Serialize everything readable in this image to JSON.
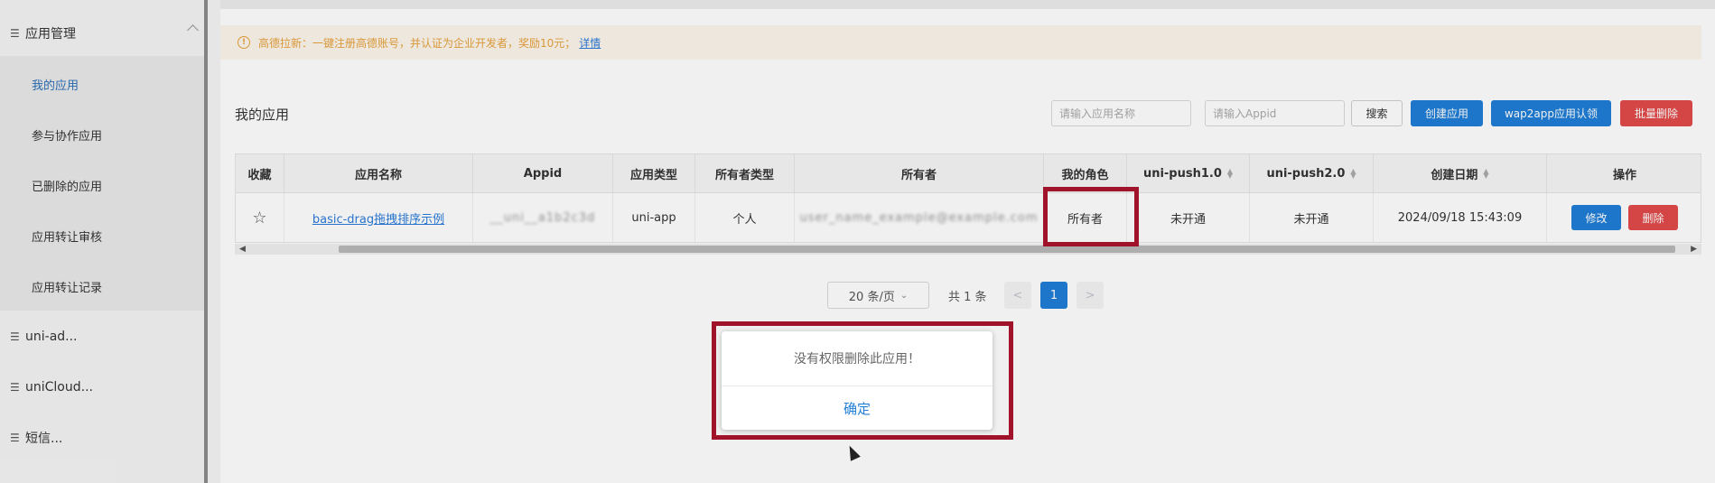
{
  "sidebar": {
    "group_label": "应用管理",
    "sub_items": [
      {
        "label": "我的应用",
        "active": true
      },
      {
        "label": "参与协作应用",
        "active": false
      },
      {
        "label": "已删除的应用",
        "active": false
      },
      {
        "label": "应用转让审核",
        "active": false
      },
      {
        "label": "应用转让记录",
        "active": false
      }
    ],
    "menu_items": [
      {
        "label": "uni-ad..."
      },
      {
        "label": "uniCloud..."
      },
      {
        "label": "短信..."
      }
    ]
  },
  "notice": {
    "text": "高德拉新：一键注册高德账号，并认证为企业开发者，奖励10元；",
    "link": "详情"
  },
  "page": {
    "title": "我的应用",
    "search_name_placeholder": "请输入应用名称",
    "search_appid_placeholder": "请输入Appid",
    "search_button": "搜索",
    "create_button": "创建应用",
    "wap2app_button": "wap2app应用认领",
    "batch_delete_button": "批量删除"
  },
  "table": {
    "headers": [
      "收藏",
      "应用名称",
      "Appid",
      "应用类型",
      "所有者类型",
      "所有者",
      "我的角色",
      "uni-push1.0",
      "uni-push2.0",
      "创建日期",
      "操作"
    ],
    "row": {
      "app_name": "basic-drag拖拽排序示例",
      "appid": "__uni__a1b2c3d",
      "app_type": "uni-app",
      "owner_type": "个人",
      "owner": "user_name_example@example.com",
      "role": "所有者",
      "push1": "未开通",
      "push2": "未开通",
      "created": "2024/09/18 15:43:09",
      "edit_label": "修改",
      "delete_label": "删除"
    }
  },
  "pagination": {
    "page_size": "20 条/页",
    "total": "共 1 条",
    "current_page": "1"
  },
  "dialog": {
    "message": "没有权限删除此应用！",
    "confirm": "确定"
  },
  "colors": {
    "primary": "#1f7ed6",
    "danger": "#e24a4a",
    "highlight": "#a0132a",
    "warning": "#e6a23c"
  }
}
